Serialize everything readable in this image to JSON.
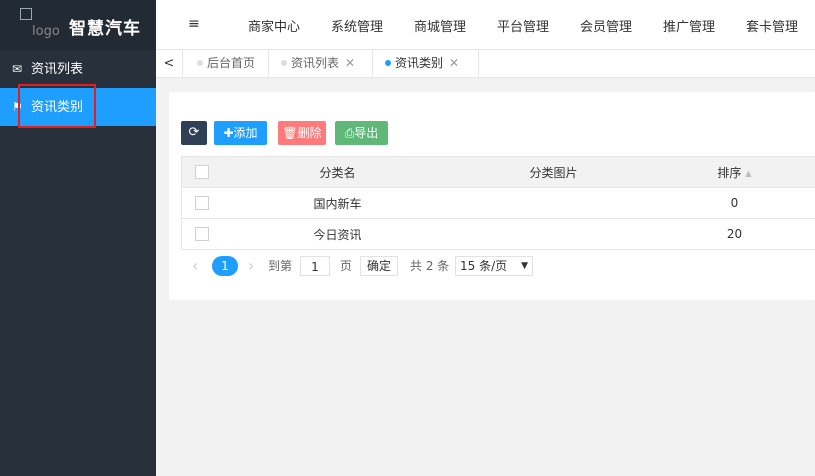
{
  "brand": {
    "logo_alt": "logo",
    "title": "智慧汽车"
  },
  "sidebar": {
    "items": [
      {
        "label": "资讯列表",
        "icon": "envelope-icon"
      },
      {
        "label": "资讯类别",
        "icon": "flag-icon",
        "active": true
      }
    ]
  },
  "topnav": {
    "fold_icon": "≡",
    "items": [
      "商家中心",
      "系统管理",
      "商城管理",
      "平台管理",
      "会员管理",
      "推广管理",
      "套卡管理"
    ]
  },
  "tabs": {
    "prev": "<",
    "items": [
      {
        "label": "后台首页"
      },
      {
        "label": "资讯列表",
        "close": "✕"
      },
      {
        "label": "资讯类别",
        "close": "✕",
        "active": true
      }
    ]
  },
  "toolbar": {
    "refresh_icon": "⟳",
    "add_label": "添加",
    "delete_label": "删除",
    "export_label": "导出"
  },
  "table": {
    "headers": [
      "分类名",
      "分类图片",
      "排序"
    ],
    "rows": [
      {
        "name": "国内新车",
        "image": "",
        "sort": "0"
      },
      {
        "name": "今日资讯",
        "image": "",
        "sort": "20"
      }
    ]
  },
  "pagination": {
    "prev": "‹",
    "current_page": "1",
    "next": "›",
    "goto_label": "到第",
    "goto_value": "1",
    "page_unit": "页",
    "confirm": "确定",
    "total": "共 2 条",
    "page_size": "15 条/页"
  },
  "colors": {
    "sidebar_bg": "#28303b",
    "accent": "#1e9fff",
    "danger": "#ff7a7a",
    "success": "#5fb878",
    "dark_button": "#2f4056",
    "highlight_box": "#e02020"
  }
}
